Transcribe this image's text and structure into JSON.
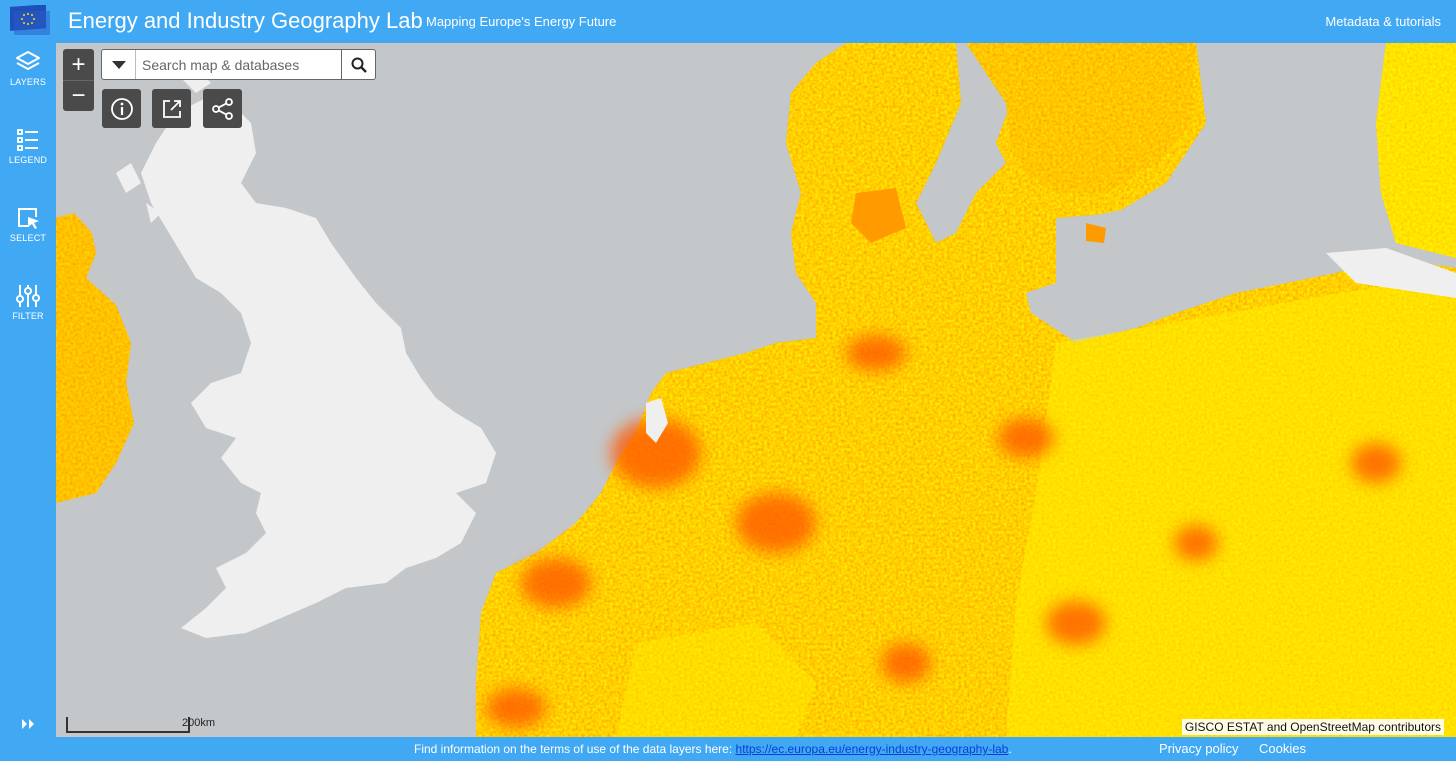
{
  "header": {
    "title": "Energy and Industry Geography Lab",
    "subtitle": "Mapping Europe's Energy Future",
    "metadata_link": "Metadata & tutorials",
    "logo_icon": "eu-flag-icon"
  },
  "sidebar": {
    "items": [
      {
        "label": "LAYERS",
        "icon": "layers-icon"
      },
      {
        "label": "LEGEND",
        "icon": "legend-list-icon"
      },
      {
        "label": "SELECT",
        "icon": "select-cursor-icon"
      },
      {
        "label": "FILTER",
        "icon": "sliders-icon"
      }
    ],
    "expand_icon": "double-chevron-right-icon"
  },
  "map": {
    "zoom_in_label": "+",
    "zoom_out_label": "−",
    "search": {
      "placeholder": "Search map & databases",
      "value": ""
    },
    "tools": [
      "info-icon",
      "open-external-icon",
      "share-icon"
    ],
    "scale_label": "200km",
    "attribution": "GISCO ESTAT and OpenStreetMap contributors"
  },
  "footer": {
    "text": "Find information on the terms of use of the data layers here: ",
    "url": "https://ec.europa.eu/energy-industry-geography-lab",
    "url_suffix": ".",
    "privacy": "Privacy policy",
    "cookies": "Cookies"
  },
  "colors": {
    "accent": "#41a9f4",
    "sea": "#c4c7c9",
    "land_uk": "#efefef",
    "heat_low": "#ffee00",
    "heat_mid": "#ffa000",
    "heat_high": "#ff6a00",
    "control_bg": "#4a4a4a"
  }
}
